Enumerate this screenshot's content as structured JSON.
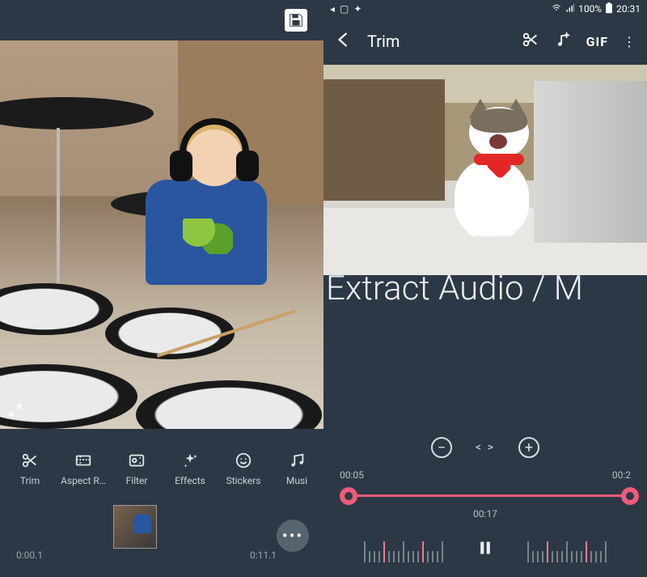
{
  "left": {
    "back_icon": "arrow-left",
    "save_icon": "save",
    "expand_icon": "expand",
    "tools": [
      {
        "id": "trim",
        "label": "Trim",
        "icon": "scissors"
      },
      {
        "id": "aspect",
        "label": "Aspect R…",
        "icon": "aspect"
      },
      {
        "id": "filter",
        "label": "Filter",
        "icon": "filter"
      },
      {
        "id": "effects",
        "label": "Effects",
        "icon": "sparkle"
      },
      {
        "id": "stickers",
        "label": "Stickers",
        "icon": "smile"
      },
      {
        "id": "music",
        "label": "Musi",
        "icon": "music"
      }
    ],
    "timeline": {
      "start": "0:00.1",
      "end": "0:11.1"
    },
    "more_icon": "more"
  },
  "right": {
    "status": {
      "battery": "100%",
      "clock": "20:31"
    },
    "header": {
      "title": "Trim",
      "cut_icon": "scissors",
      "music_icon": "music-add",
      "gif_label": "GIF",
      "more_icon": "more-vert"
    },
    "overlay_text": "Extract Audio / M",
    "zoom": {
      "out": "−",
      "code": "< >",
      "in": "+"
    },
    "trim": {
      "start": "00:05",
      "end": "00:2",
      "mid": "00:17"
    },
    "playback": {
      "pause_icon": "pause"
    }
  }
}
